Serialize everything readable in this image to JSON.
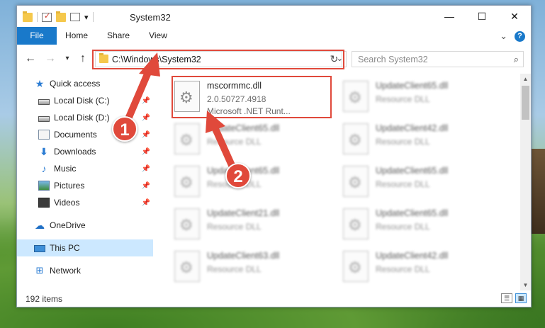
{
  "window": {
    "title": "System32",
    "minimize_glyph": "—",
    "maximize_glyph": "☐",
    "close_glyph": "✕"
  },
  "quick_access_toolbar": {
    "dropdown_glyph": "▾"
  },
  "ribbon": {
    "tabs": [
      {
        "label": "File",
        "active": true
      },
      {
        "label": "Home"
      },
      {
        "label": "Share"
      },
      {
        "label": "View"
      }
    ],
    "expand_glyph": "⌄",
    "help_glyph": "?"
  },
  "navigation": {
    "back_glyph": "←",
    "forward_glyph": "→",
    "recent_glyph": "▾",
    "up_glyph": "↑",
    "address": "C:\\Windows\\System32",
    "address_dropdown_glyph": "⌄",
    "refresh_glyph": "↻",
    "search_placeholder": "Search System32",
    "search_glyph": "⌕"
  },
  "sidebar": {
    "items": [
      {
        "label": "Quick access",
        "icon": "star-icon",
        "pinned": false
      },
      {
        "label": "Local Disk (C:)",
        "icon": "disk-icon",
        "pinned": true
      },
      {
        "label": "Local Disk (D:)",
        "icon": "disk-icon",
        "pinned": true
      },
      {
        "label": "Documents",
        "icon": "documents-icon",
        "pinned": true
      },
      {
        "label": "Downloads",
        "icon": "download-icon",
        "pinned": true
      },
      {
        "label": "Music",
        "icon": "music-icon",
        "pinned": true
      },
      {
        "label": "Pictures",
        "icon": "pictures-icon",
        "pinned": true
      },
      {
        "label": "Videos",
        "icon": "videos-icon",
        "pinned": true
      },
      {
        "label": "OneDrive",
        "icon": "onedrive-icon"
      },
      {
        "label": "This PC",
        "icon": "this-pc-icon",
        "selected": true
      },
      {
        "label": "Network",
        "icon": "network-icon"
      }
    ],
    "pin_glyph": "📌"
  },
  "files": [
    {
      "name": "mscormmc.dll",
      "line1": "2.0.50727.4918",
      "line2": "Microsoft .NET Runt...",
      "highlighted": true
    },
    {
      "name": "UpdateClient65.dll",
      "line1": "Resource DLL",
      "blurred": true
    },
    {
      "name": "UpdateClient65.dll",
      "line1": "Resource DLL",
      "blurred": true
    },
    {
      "name": "UpdateClient42.dll",
      "line1": "Resource DLL",
      "blurred": true
    },
    {
      "name": "UpdateClient65.dll",
      "line1": "Resource DLL",
      "blurred": true
    },
    {
      "name": "UpdateClient65.dll",
      "line1": "Resource DLL",
      "blurred": true
    },
    {
      "name": "UpdateClient21.dll",
      "line1": "Resource DLL",
      "blurred": true
    },
    {
      "name": "UpdateClient65.dll",
      "line1": "Resource DLL",
      "blurred": true
    },
    {
      "name": "UpdateClient63.dll",
      "line1": "Resource DLL",
      "blurred": true
    },
    {
      "name": "UpdateClient42.dll",
      "line1": "Resource DLL",
      "blurred": true
    }
  ],
  "status": {
    "item_count": "192 items"
  },
  "annotations": [
    {
      "number": "1",
      "target": "address bar"
    },
    {
      "number": "2",
      "target": "mscormmc.dll"
    }
  ],
  "colors": {
    "accent": "#1979ca",
    "annotation_red": "#e0493b",
    "selected_bg": "#cce8ff"
  }
}
